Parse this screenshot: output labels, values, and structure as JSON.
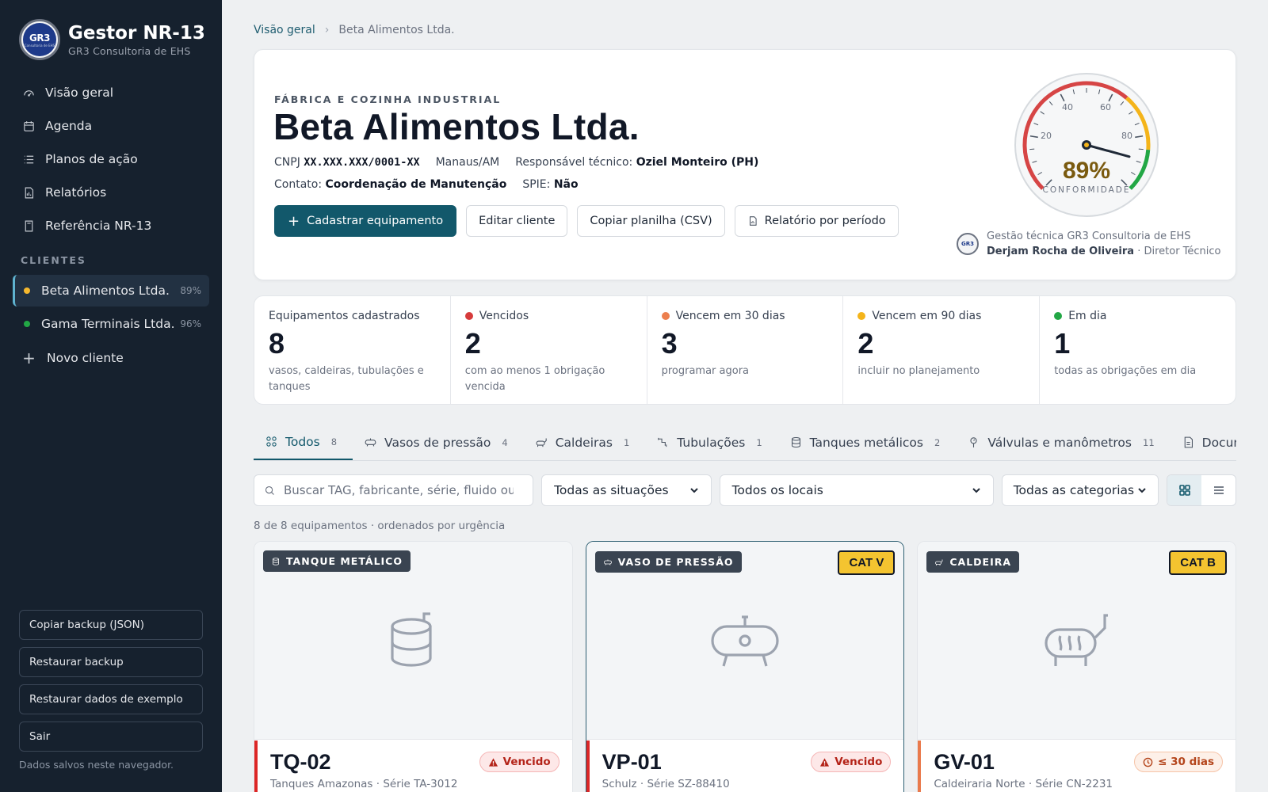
{
  "brand": {
    "title": "Gestor NR-13",
    "subtitle": "GR3 Consultoria de EHS",
    "logo_text": "GR3",
    "logo_sub": "Consultoria de EHS"
  },
  "nav": [
    {
      "label": "Visão geral",
      "icon": "gauge-icon"
    },
    {
      "label": "Agenda",
      "icon": "calendar-icon"
    },
    {
      "label": "Planos de ação",
      "icon": "list-icon"
    },
    {
      "label": "Relatórios",
      "icon": "report-icon"
    },
    {
      "label": "Referência NR-13",
      "icon": "book-icon"
    }
  ],
  "clients_label": "CLIENTES",
  "clients": [
    {
      "name": "Beta Alimentos Ltda.",
      "pct": "89%",
      "color": "#f5b82e",
      "active": true
    },
    {
      "name": "Gama Terminais Ltda.",
      "pct": "96%",
      "color": "#22a745",
      "active": false
    }
  ],
  "new_client": "Novo cliente",
  "side_buttons": [
    "Copiar backup (JSON)",
    "Restaurar backup",
    "Restaurar dados de exemplo",
    "Sair"
  ],
  "side_note": "Dados salvos neste navegador.",
  "breadcrumb": {
    "root": "Visão geral",
    "current": "Beta Alimentos Ltda."
  },
  "hero": {
    "eyebrow": "FÁBRICA E COZINHA INDUSTRIAL",
    "title": "Beta Alimentos Ltda.",
    "cnpj_label": "CNPJ",
    "cnpj": "XX.XXX.XXX/0001-XX",
    "city": "Manaus/AM",
    "resp_label": "Responsável técnico:",
    "resp": "Oziel Monteiro (PH)",
    "contact_label": "Contato:",
    "contact": "Coordenação de Manutenção",
    "spie_label": "SPIE:",
    "spie": "Não",
    "btn_add": "Cadastrar equipamento",
    "btn_edit": "Editar cliente",
    "btn_csv": "Copiar planilha (CSV)",
    "btn_report": "Relatório por período"
  },
  "gauge": {
    "value": 89,
    "display": "89%",
    "label": "CONFORMIDADE",
    "ticks": [
      "20",
      "40",
      "60",
      "80"
    ]
  },
  "tech": {
    "line1": "Gestão técnica GR3 Consultoria de EHS",
    "name": "Derjam Rocha de Oliveira",
    "role": "· Diretor Técnico"
  },
  "stats": [
    {
      "label": "Equipamentos cadastrados",
      "value": "8",
      "desc": "vasos, caldeiras, tubulações e tanques",
      "dot": ""
    },
    {
      "label": "Vencidos",
      "value": "2",
      "desc": "com ao menos 1 obrigação vencida",
      "dot": "#d63b3b"
    },
    {
      "label": "Vencem em 30 dias",
      "value": "3",
      "desc": "programar agora",
      "dot": "#ec7f4e"
    },
    {
      "label": "Vencem em 90 dias",
      "value": "2",
      "desc": "incluir no planejamento",
      "dot": "#f4b41a"
    },
    {
      "label": "Em dia",
      "value": "1",
      "desc": "todas as obrigações em dia",
      "dot": "#22a745"
    }
  ],
  "tabs": [
    {
      "label": "Todos",
      "count": "8",
      "icon": "grid-icon"
    },
    {
      "label": "Vasos de pressão",
      "count": "4",
      "icon": "pressure-vessel-icon"
    },
    {
      "label": "Caldeiras",
      "count": "1",
      "icon": "boiler-icon"
    },
    {
      "label": "Tubulações",
      "count": "1",
      "icon": "piping-icon"
    },
    {
      "label": "Tanques metálicos",
      "count": "2",
      "icon": "tank-icon"
    },
    {
      "label": "Válvulas e manômetros",
      "count": "11",
      "icon": "valve-icon"
    },
    {
      "label": "Documentos",
      "count": "",
      "icon": "document-icon"
    }
  ],
  "filters": {
    "search_placeholder": "Buscar TAG, fabricante, série, fluido ou local",
    "situation": "Todas as situações",
    "location": "Todos os locais",
    "category": "Todas as categorias"
  },
  "result_count": "8 de 8 equipamentos · ordenados por urgência",
  "cards": [
    {
      "type": "TANQUE METÁLICO",
      "cat": "",
      "tag": "TQ-02",
      "sub": "Tanques Amazonas · Série TA-3012",
      "status": "Vencido"
    },
    {
      "type": "VASO DE PRESSÃO",
      "cat": "CAT V",
      "tag": "VP-01",
      "sub": "Schulz · Série SZ-88410",
      "status": "Vencido"
    },
    {
      "type": "CALDEIRA",
      "cat": "CAT B",
      "tag": "GV-01",
      "sub": "Caldeiraria Norte · Série CN-2231",
      "status": "≤ 30 dias"
    }
  ]
}
